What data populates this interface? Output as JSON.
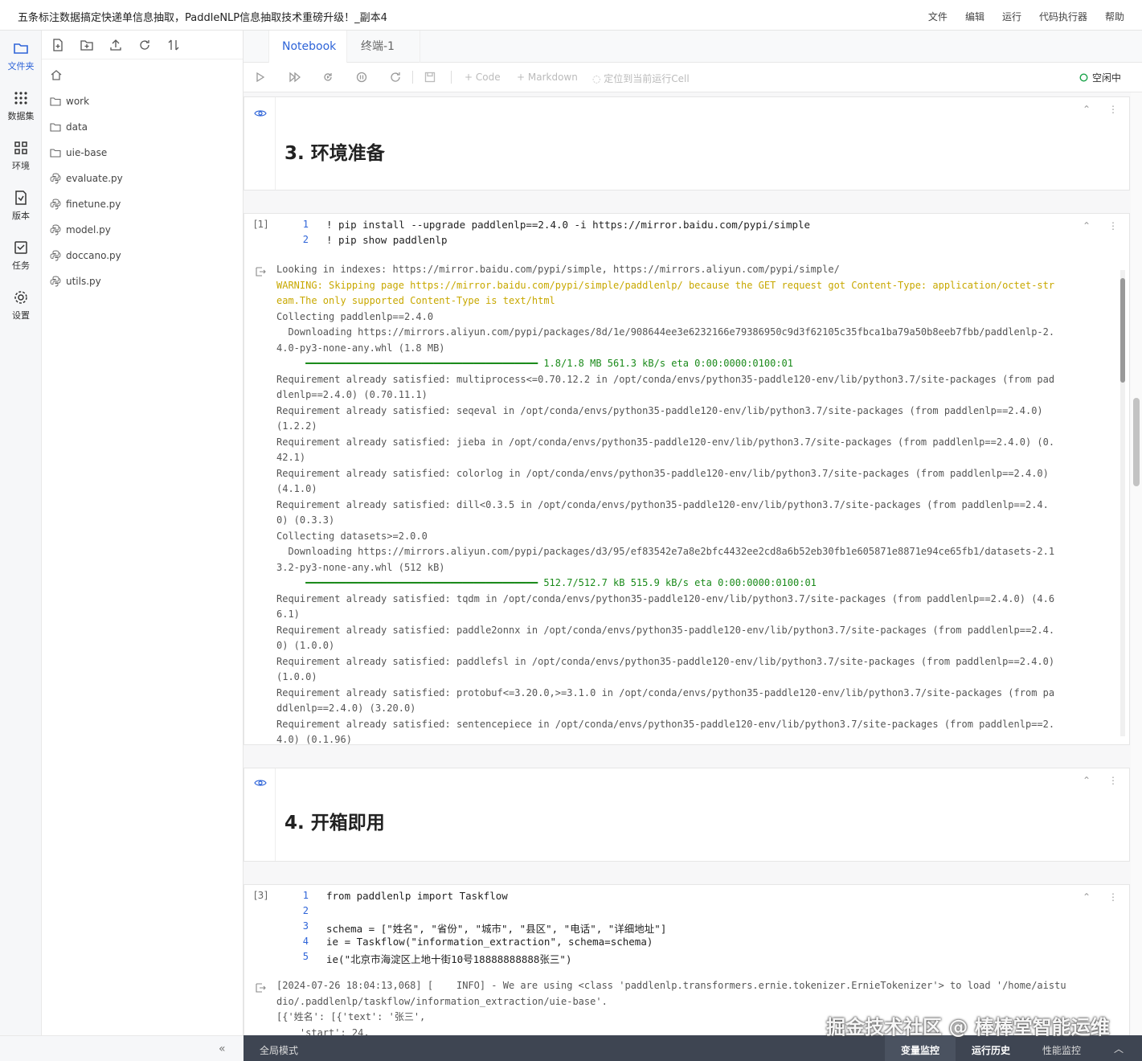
{
  "title": "五条标注数据搞定快递单信息抽取，PaddleNLP信息抽取技术重磅升级！_副本4",
  "menu": [
    "文件",
    "编辑",
    "运行",
    "代码执行器",
    "帮助"
  ],
  "activity": [
    {
      "label": "文件夹",
      "icon": "folder-icon"
    },
    {
      "label": "数据集",
      "icon": "dataset-icon"
    },
    {
      "label": "环境",
      "icon": "grid-icon"
    },
    {
      "label": "版本",
      "icon": "version-icon"
    },
    {
      "label": "任务",
      "icon": "task-icon"
    },
    {
      "label": "设置",
      "icon": "gear-icon"
    }
  ],
  "files": [
    {
      "name": "work",
      "type": "folder"
    },
    {
      "name": "data",
      "type": "folder"
    },
    {
      "name": "uie-base",
      "type": "folder"
    },
    {
      "name": "evaluate.py",
      "type": "python"
    },
    {
      "name": "finetune.py",
      "type": "python"
    },
    {
      "name": "model.py",
      "type": "python"
    },
    {
      "name": "doccano.py",
      "type": "python"
    },
    {
      "name": "utils.py",
      "type": "python"
    }
  ],
  "tabs": {
    "notebook": "Notebook",
    "terminal": "终端-1"
  },
  "toolbar": {
    "code": "Code",
    "markdown": "Markdown",
    "locate": "定位到当前运行Cell",
    "status": "空闲中"
  },
  "cells": {
    "md1": "3. 环境准备",
    "code1_prompt": "[1]",
    "code1_lines": [
      "! pip install --upgrade paddlenlp==2.4.0 -i https://mirror.baidu.com/pypi/simple",
      "! pip show paddlenlp"
    ],
    "out1": [
      "Looking in indexes: https://mirror.baidu.com/pypi/simple, https://mirrors.aliyun.com/pypi/simple/",
      "WARNING: Skipping page https://mirror.baidu.com/pypi/simple/paddlenlp/ because the GET request got Content-Type: application/octet-str",
      "eam.The only supported Content-Type is text/html",
      "Collecting paddlenlp==2.4.0",
      "  Downloading https://mirrors.aliyun.com/pypi/packages/8d/1e/908644ee3e6232166e79386950c9d3f62105c35fbca1ba79a50b8eeb7fbb/paddlenlp-2.",
      "4.0-py3-none-any.whl (1.8 MB)",
      "     ━━━━━━━━━━━━━━━━━━━━━━━━━━━━━━━━━━━━━━━━ 1.8/1.8 MB 561.3 kB/s eta 0:00:0000:0100:01",
      "Requirement already satisfied: multiprocess<=0.70.12.2 in /opt/conda/envs/python35-paddle120-env/lib/python3.7/site-packages (from pad",
      "dlenlp==2.4.0) (0.70.11.1)",
      "Requirement already satisfied: seqeval in /opt/conda/envs/python35-paddle120-env/lib/python3.7/site-packages (from paddlenlp==2.4.0)",
      "(1.2.2)",
      "Requirement already satisfied: jieba in /opt/conda/envs/python35-paddle120-env/lib/python3.7/site-packages (from paddlenlp==2.4.0) (0.",
      "42.1)",
      "Requirement already satisfied: colorlog in /opt/conda/envs/python35-paddle120-env/lib/python3.7/site-packages (from paddlenlp==2.4.0)",
      "(4.1.0)",
      "Requirement already satisfied: dill<0.3.5 in /opt/conda/envs/python35-paddle120-env/lib/python3.7/site-packages (from paddlenlp==2.4.",
      "0) (0.3.3)",
      "Collecting datasets>=2.0.0",
      "  Downloading https://mirrors.aliyun.com/pypi/packages/d3/95/ef83542e7a8e2bfc4432ee2cd8a6b52eb30fb1e605871e8871e94ce65fb1/datasets-2.1",
      "3.2-py3-none-any.whl (512 kB)",
      "     ━━━━━━━━━━━━━━━━━━━━━━━━━━━━━━━━━━━━━━━━ 512.7/512.7 kB 515.9 kB/s eta 0:00:0000:0100:01",
      "Requirement already satisfied: tqdm in /opt/conda/envs/python35-paddle120-env/lib/python3.7/site-packages (from paddlenlp==2.4.0) (4.6",
      "6.1)",
      "Requirement already satisfied: paddle2onnx in /opt/conda/envs/python35-paddle120-env/lib/python3.7/site-packages (from paddlenlp==2.4.",
      "0) (1.0.0)",
      "Requirement already satisfied: paddlefsl in /opt/conda/envs/python35-paddle120-env/lib/python3.7/site-packages (from paddlenlp==2.4.0)",
      "(1.0.0)",
      "Requirement already satisfied: protobuf<=3.20.0,>=3.1.0 in /opt/conda/envs/python35-paddle120-env/lib/python3.7/site-packages (from pa",
      "ddlenlp==2.4.0) (3.20.0)",
      "Requirement already satisfied: sentencepiece in /opt/conda/envs/python35-paddle120-env/lib/python3.7/site-packages (from paddlenlp==2.",
      "4.0) (0.1.96)"
    ],
    "md2": "4. 开箱即用",
    "code2_prompt": "[3]",
    "code2_lines": [
      "from paddlenlp import Taskflow",
      "",
      "schema = [\"姓名\", \"省份\", \"城市\", \"县区\", \"电话\", \"详细地址\"]",
      "ie = Taskflow(\"information_extraction\", schema=schema)",
      "ie(\"北京市海淀区上地十街10号18888888888张三\")"
    ],
    "out2": [
      "[2024-07-26 18:04:13,068] [    INFO] - We are using <class 'paddlenlp.transformers.ernie.tokenizer.ErnieTokenizer'> to load '/home/aistu",
      "dio/.paddlenlp/taskflow/information_extraction/uie-base'.",
      "[{'姓名': [{'text': '张三',",
      "    'start': 24,"
    ]
  },
  "bottom": {
    "mode": "全局模式",
    "var": "变量监控",
    "history": "运行历史",
    "perf": "性能监控"
  },
  "watermark": "掘金技术社区 @ 棒棒堂智能运维",
  "colors": {
    "accent": "#2e64d8",
    "warning": "#c8a800",
    "status": "#1aa34a"
  }
}
